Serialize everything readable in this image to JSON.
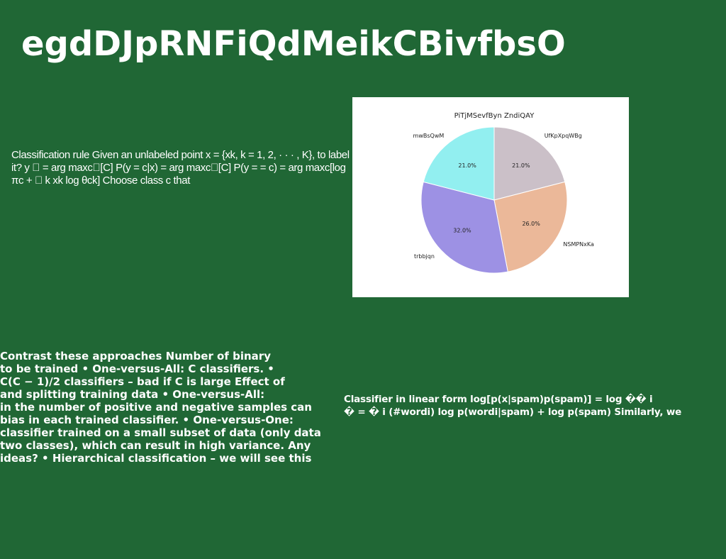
{
  "slide": {
    "title": "egdDJpRNFiQdMeikCBivfbsO",
    "background_color": "#206735",
    "text_block_1": "Classification rule Given an unlabeled point x = {xk, k = 1, 2, · · · , K}, to label it? y \u0000 = arg maxc\u0000[C] P(y = c|x) = arg maxc\u0000[C] P(y = = c) = arg maxc[log πc + \u0000 k xk log θck] Choose class c that",
    "text_block_2_lines": [
      "Contrast these approaches Number of binary",
      "to be trained • One-versus-All: C classifiers. •",
      "C(C − 1)/2 classifiers – bad if C is large Effect of",
      "and splitting training data • One-versus-All:",
      "in the number of positive and negative samples can",
      "bias in each trained classifier. • One-versus-One:",
      "classifier trained on a small subset of data (only data",
      "two classes), which can result in high variance. Any",
      "ideas? • Hierarchical classification – we will see this"
    ],
    "text_block_3_lines": [
      "Classifier in linear form log[p(x|spam)p(spam)] = log �� i",
      "� = � i (#wordi) log p(wordi|spam) + log p(spam) Similarly, we"
    ]
  },
  "chart_data": {
    "type": "pie",
    "title": "PiTjMSevfByn ZndiQAY",
    "labels": [
      "UfKpXpqWBg",
      "NSMPNxKa",
      "trbbjqn",
      "mwBsQwM"
    ],
    "values": [
      21.0,
      26.0,
      32.0,
      21.0
    ],
    "percent_labels": [
      "21.0%",
      "26.0%",
      "32.0%",
      "21.0%"
    ],
    "colors": [
      "#cbc0c8",
      "#ebb899",
      "#9d91e4",
      "#92eff0"
    ],
    "start_angle_deg": 90,
    "direction": "clockwise",
    "legend": "none"
  }
}
